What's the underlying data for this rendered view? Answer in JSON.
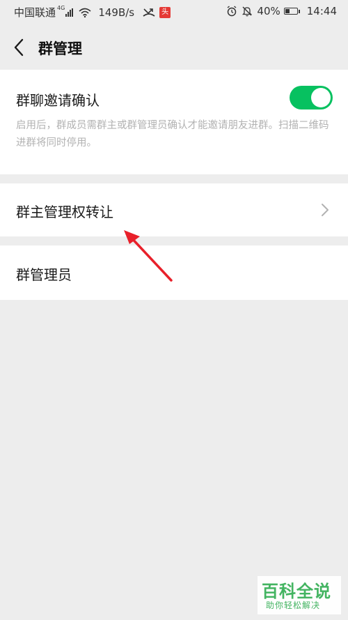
{
  "status_bar": {
    "carrier": "中国联通",
    "network_type": "4G",
    "speed": "149B/s",
    "app_badge": "头",
    "battery": "40%",
    "battery_level": 0.4,
    "time": "14:44",
    "icons": [
      "signal-icon",
      "wifi-icon",
      "missed-call-icon",
      "alarm-icon",
      "bell-off-icon",
      "battery-icon"
    ]
  },
  "nav": {
    "title": "群管理",
    "back_icon": "chevron-left-icon"
  },
  "settings": {
    "invite_confirm": {
      "label": "群聊邀请确认",
      "enabled": true,
      "description": "启用后，群成员需群主或群管理员确认才能邀请朋友进群。扫描二维码进群将同时停用。"
    },
    "transfer_owner": {
      "label": "群主管理权转让",
      "icon": "chevron-right-icon"
    },
    "admins": {
      "label": "群管理员"
    }
  },
  "colors": {
    "accent": "#07c160",
    "annotation_arrow": "#e8202a",
    "background": "#ededed"
  },
  "watermark": {
    "title": "百科全说",
    "subtitle": "助你轻松解决"
  }
}
